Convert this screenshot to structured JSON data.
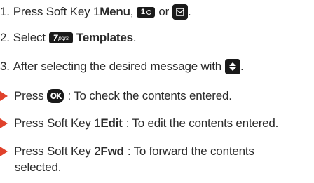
{
  "steps": [
    {
      "num": "1.",
      "pre": "Press Soft Key 1 ",
      "bold": "Menu",
      "post": ",",
      "or": "or",
      "key1_label": "1",
      "key2_icon": "envelope-icon"
    },
    {
      "num": "2.",
      "pre": "Select",
      "key_label": "7",
      "key_sub": "pqrs",
      "bold": "Templates",
      "post": "."
    },
    {
      "num": "3.",
      "pre": "After selecting the desired message with",
      "post": ".",
      "key_icon": "navigation-updown-icon"
    }
  ],
  "bullets": [
    {
      "pre": "Press",
      "key_label": "OK",
      "post": ": To check the contents entered."
    },
    {
      "pre": "Press Soft Key 1 ",
      "bold": "Edit",
      "post": ": To edit the contents entered."
    },
    {
      "pre": "Press Soft Key 2 ",
      "bold": "Fwd",
      "post": ": To forward the contents",
      "cont": "selected."
    }
  ],
  "colors": {
    "bullet": "#e0412b",
    "text": "#2a2a2a",
    "key": "#1a1a1a"
  }
}
